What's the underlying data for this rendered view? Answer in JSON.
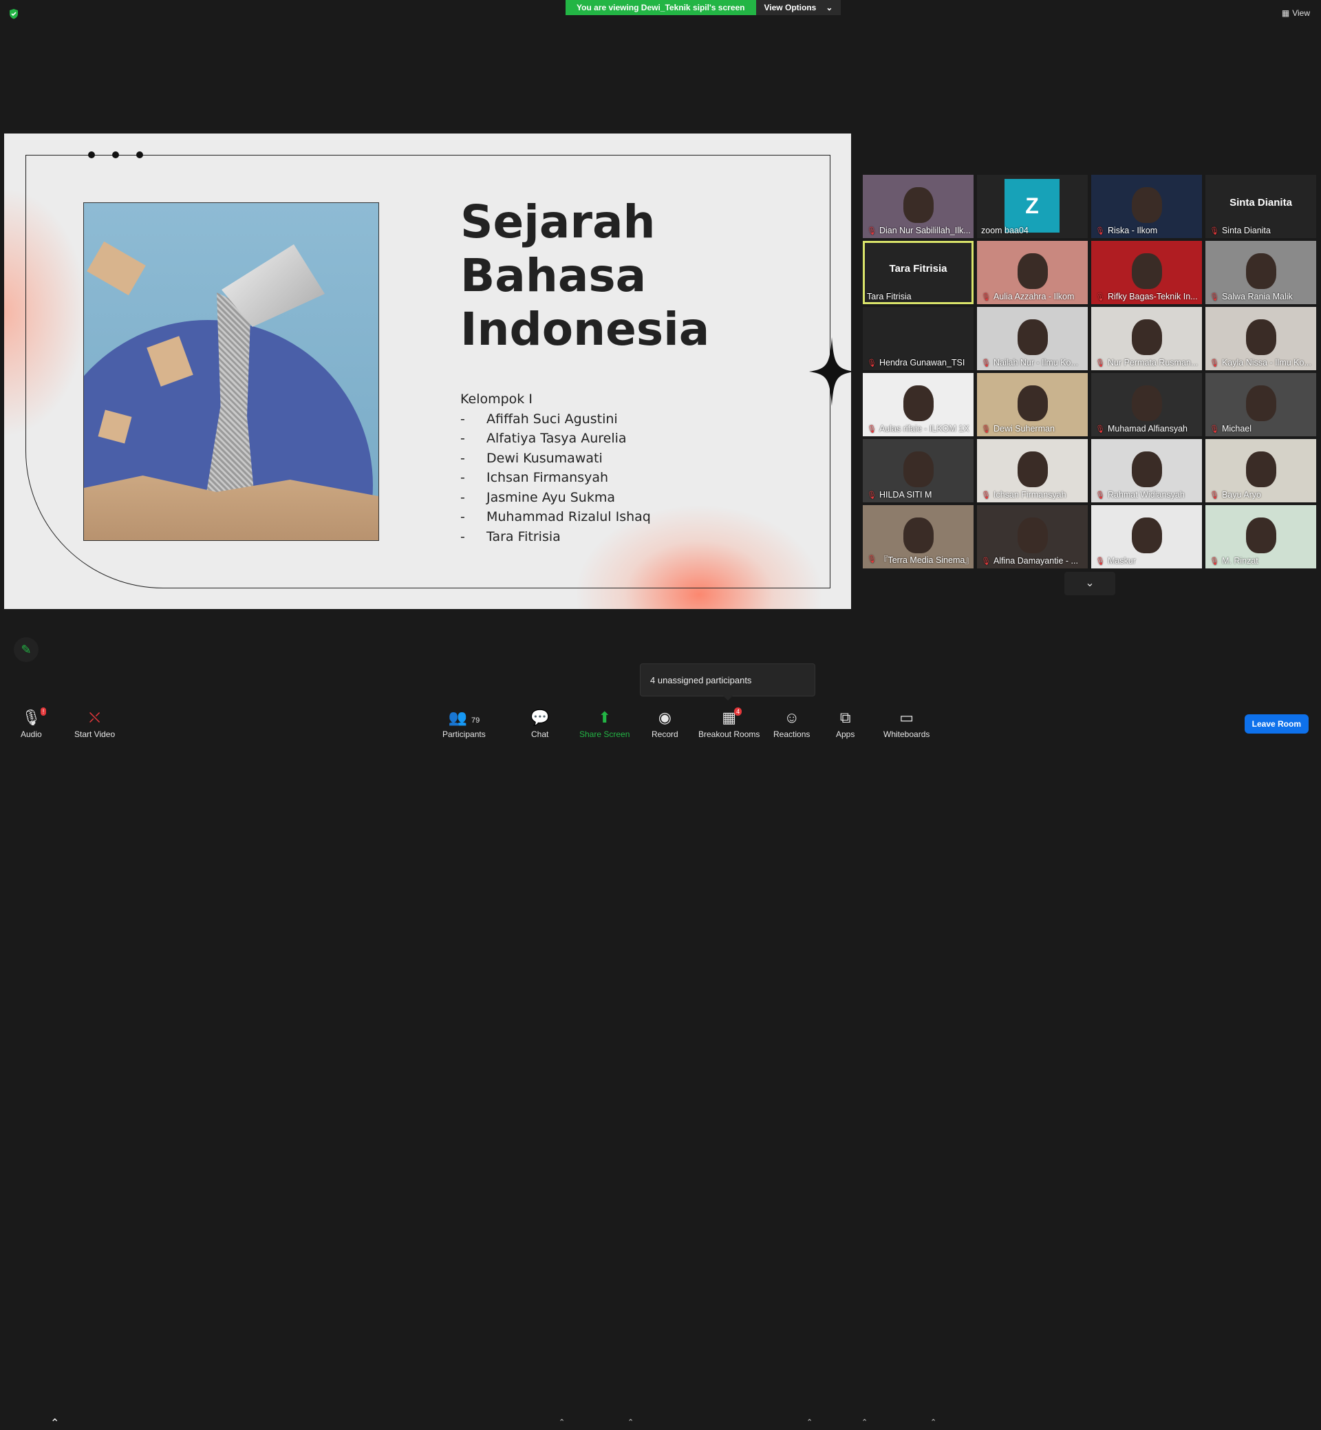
{
  "banner": {
    "viewing": "You are viewing Dewi_Teknik sipil's screen",
    "view_options": "View Options",
    "view_button": "View"
  },
  "slide": {
    "title_lines": [
      "Sejarah",
      "Bahasa",
      "Indonesia"
    ],
    "group_label": "Kelompok I",
    "members": [
      "Afiffah Suci Agustini",
      "Alfatiya Tasya Aurelia",
      "Dewi Kusumawati",
      "Ichsan Firmansyah",
      "Jasmine Ayu Sukma",
      "Muhammad Rizalul Ishaq",
      "Tara Fitrisia"
    ],
    "dash": "-"
  },
  "participants": [
    {
      "name": "Dian Nur Sabilillah_Ilk...",
      "muted": true,
      "kind": "video",
      "bg": "#6b5a6e"
    },
    {
      "name": "zoom baa04",
      "muted": false,
      "kind": "initial",
      "initial": "Z"
    },
    {
      "name": "Riska - Ilkom",
      "muted": true,
      "kind": "video",
      "bg": "#1d2a44"
    },
    {
      "name": "Sinta Dianita",
      "muted": true,
      "kind": "name",
      "big": "Sinta Dianita"
    },
    {
      "name": "Tara Fitrisia",
      "muted": false,
      "kind": "name",
      "big": "Tara Fitrisia",
      "active": true
    },
    {
      "name": "Aulia Azzahra - Ilkom",
      "muted": true,
      "kind": "video",
      "bg": "#c9887f"
    },
    {
      "name": "Rifky Bagas-Teknik In...",
      "muted": true,
      "kind": "video",
      "bg": "#b01d22"
    },
    {
      "name": "Salwa Rania Malik",
      "muted": true,
      "kind": "video",
      "bg": "#8a8a8a"
    },
    {
      "name": "Hendra Gunawan_TSI",
      "muted": true,
      "kind": "blank"
    },
    {
      "name": "Nailah Nur - Ilmu Ko...",
      "muted": true,
      "kind": "video",
      "bg": "#cfcfcf"
    },
    {
      "name": "Nur Permata Rusman...",
      "muted": true,
      "kind": "video",
      "bg": "#d8d6d2"
    },
    {
      "name": "Kayla Nissa - Ilmu Ko...",
      "muted": true,
      "kind": "video",
      "bg": "#cfcac4"
    },
    {
      "name": "Aulas rifaie - ILKOM 1X",
      "muted": true,
      "kind": "video",
      "bg": "#eeeeee"
    },
    {
      "name": "Dewi Suherman",
      "muted": true,
      "kind": "video",
      "bg": "#c9b38e"
    },
    {
      "name": "Muhamad Alfiansyah",
      "muted": true,
      "kind": "video",
      "bg": "#2e2e2e"
    },
    {
      "name": "Michael",
      "muted": true,
      "kind": "video",
      "bg": "#4a4a4a"
    },
    {
      "name": "HILDA SITI M",
      "muted": true,
      "kind": "video",
      "bg": "#3b3b3b"
    },
    {
      "name": "Ichsan Firmansyah",
      "muted": true,
      "kind": "video",
      "bg": "#e0ddd8"
    },
    {
      "name": "Rahmat Widiansyah",
      "muted": true,
      "kind": "video",
      "bg": "#d9d9d9"
    },
    {
      "name": "Bayu Aryo",
      "muted": true,
      "kind": "video",
      "bg": "#d5d2c8"
    },
    {
      "name": "『Terra Media Sinema』",
      "muted": true,
      "kind": "video",
      "bg": "#8d7c6b"
    },
    {
      "name": "Alfina Damayantie - ...",
      "muted": true,
      "kind": "video",
      "bg": "#3a3330"
    },
    {
      "name": "Maskur",
      "muted": true,
      "kind": "video",
      "bg": "#e8e8e8"
    },
    {
      "name": "M. Rinzat",
      "muted": true,
      "kind": "video",
      "bg": "#cfe0d2"
    }
  ],
  "tooltip": "4 unassigned participants",
  "toolbar": {
    "audio": "Audio",
    "audio_badge": "!",
    "start_video": "Start Video",
    "participants": "Participants",
    "participants_count": "79",
    "chat": "Chat",
    "share_screen": "Share Screen",
    "record": "Record",
    "breakout_rooms": "Breakout Rooms",
    "breakout_badge": "4",
    "reactions": "Reactions",
    "apps": "Apps",
    "whiteboards": "Whiteboards",
    "leave_room": "Leave Room"
  },
  "colors": {
    "share_green": "#23b545",
    "active_speaker": "#d9e36a",
    "leave_blue": "#0e71eb",
    "mute_red": "#e5383b"
  }
}
